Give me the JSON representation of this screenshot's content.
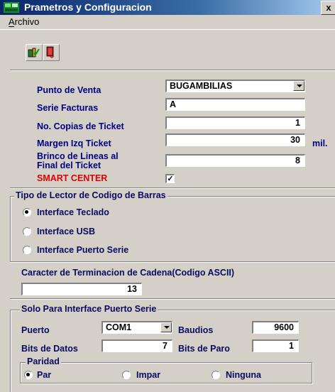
{
  "window": {
    "title": "Prametros y Configuracion",
    "close_glyph": "x"
  },
  "menu": {
    "archivo": "Archivo"
  },
  "toolbar": {
    "buttons": [
      {
        "icon": "save-exit-icon"
      },
      {
        "icon": "exit-door-icon"
      }
    ]
  },
  "general": {
    "punto_venta": {
      "label": "Punto de Venta",
      "value": "BUGAMBILIAS"
    },
    "serie_facturas": {
      "label": "Serie Facturas",
      "value": "A"
    },
    "copias_ticket": {
      "label": "No. Copias de Ticket",
      "value": "1"
    },
    "margen_izq": {
      "label": "Margen Izq Ticket",
      "value": "30",
      "unit": "mil."
    },
    "brinco_lineas": {
      "label_line1": "Brinco de Lineas al",
      "label_line2": "Final del Ticket",
      "value": "8"
    },
    "smart_center": {
      "label": "SMART CENTER",
      "checked": true,
      "check_glyph": "✓"
    }
  },
  "lector": {
    "legend": "Tipo de Lector de Codigo de Barras",
    "options": [
      {
        "label": "Interface Teclado",
        "selected": true
      },
      {
        "label": "Interface USB",
        "selected": false
      },
      {
        "label": "Interface Puerto Serie",
        "selected": false
      }
    ]
  },
  "terminacion": {
    "label": "Caracter de Terminacion de Cadena(Codigo ASCII)",
    "value": "13"
  },
  "serie": {
    "legend": "Solo Para Interface Puerto Serie",
    "puerto": {
      "label": "Puerto",
      "value": "COM1"
    },
    "baudios": {
      "label": "Baudios",
      "value": "9600"
    },
    "bits_datos": {
      "label": "Bits de Datos",
      "value": "7"
    },
    "bits_paro": {
      "label": "Bits de Paro",
      "value": "1"
    },
    "paridad": {
      "legend": "Paridad",
      "options": [
        {
          "label": "Par",
          "selected": true
        },
        {
          "label": "Impar",
          "selected": false
        },
        {
          "label": "Ninguna",
          "selected": false
        }
      ]
    }
  }
}
